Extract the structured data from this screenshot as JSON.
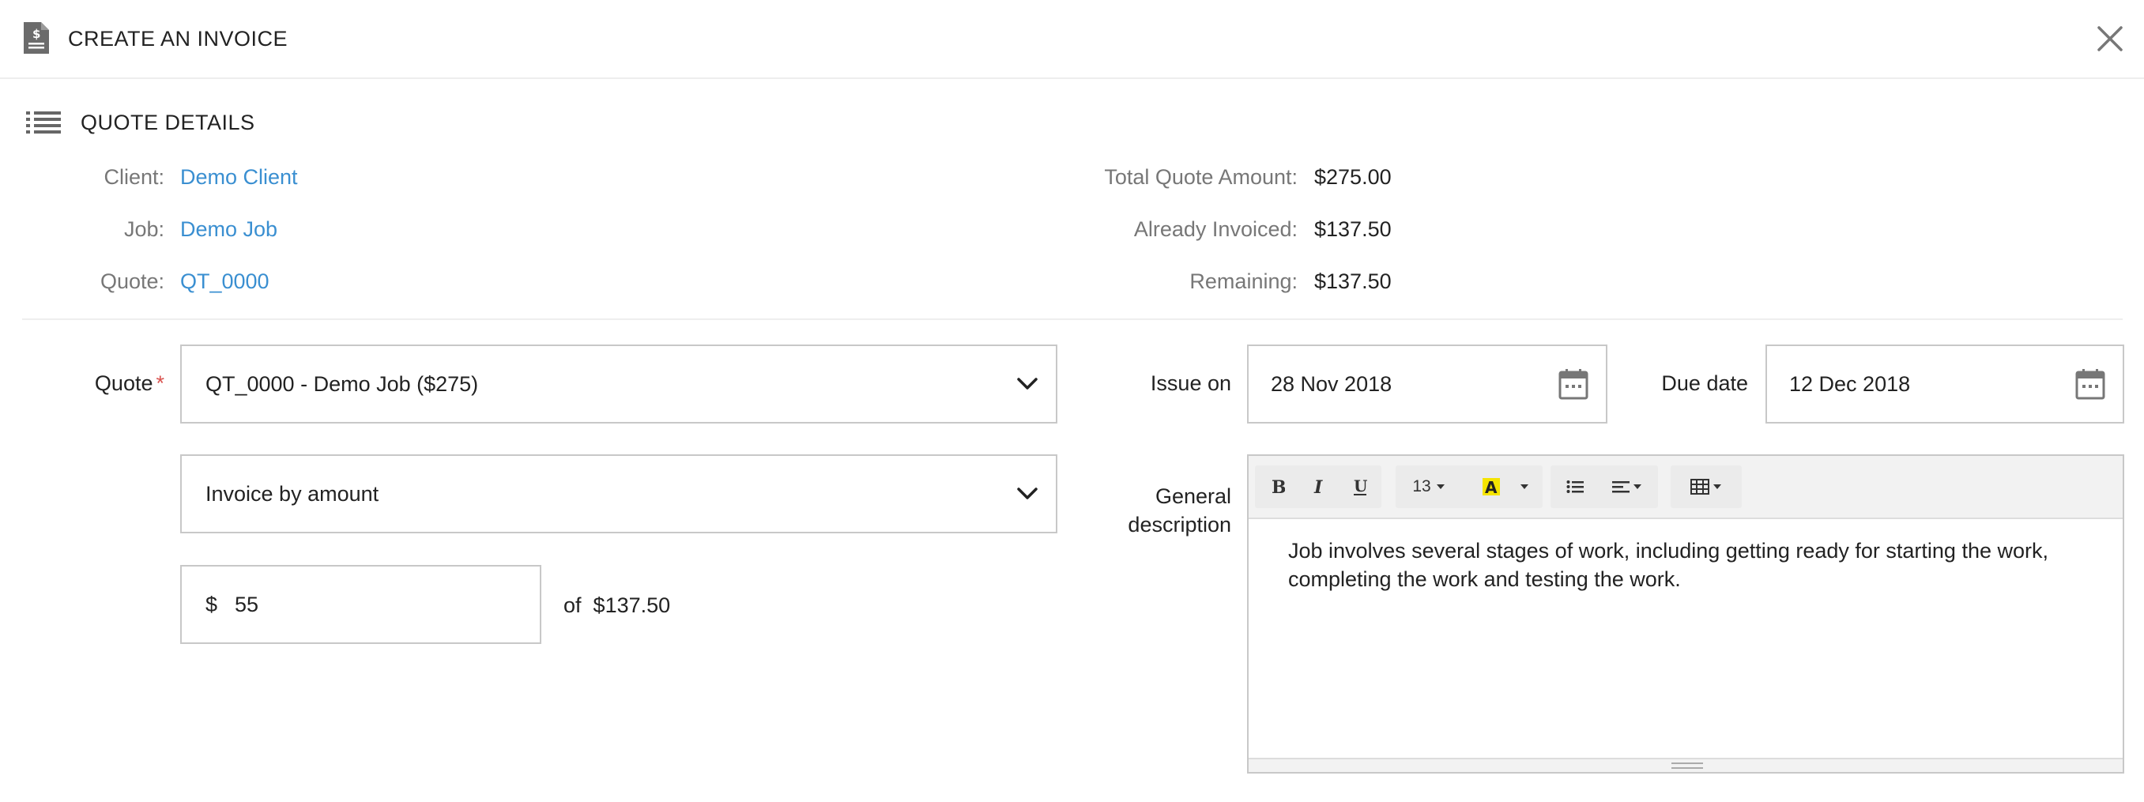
{
  "header": {
    "title": "CREATE AN INVOICE",
    "doc_icon": "invoice-document-icon",
    "close_icon": "close-icon"
  },
  "quote_details": {
    "title": "QUOTE DETAILS",
    "icon": "list-icon",
    "client_label": "Client:",
    "client_value": "Demo Client",
    "job_label": "Job:",
    "job_value": "Demo Job",
    "quote_label": "Quote:",
    "quote_value": "QT_0000",
    "total_label": "Total Quote Amount:",
    "total_value": "$275.00",
    "invoiced_label": "Already Invoiced:",
    "invoiced_value": "$137.50",
    "remaining_label": "Remaining:",
    "remaining_value": "$137.50"
  },
  "form": {
    "quote_label": "Quote",
    "required_mark": "*",
    "quote_select_value": "QT_0000 - Demo Job ($275)",
    "invoice_type_value": "Invoice by amount",
    "currency_symbol": "$",
    "amount_value": "55",
    "of_label": "of",
    "of_amount": "$137.50",
    "issue_label": "Issue on",
    "issue_value": "28 Nov 2018",
    "due_label": "Due date",
    "due_value": "12 Dec 2018",
    "description_label_line1": "General",
    "description_label_line2": "description",
    "font_size_value": "13",
    "description_text": "Job involves several stages of work, including getting ready for starting the work, completing the work and testing the work."
  },
  "colors": {
    "link": "#3a8fd1",
    "required": "#d9534f",
    "border": "#c8c8c8",
    "highlight": "#f5e400"
  }
}
